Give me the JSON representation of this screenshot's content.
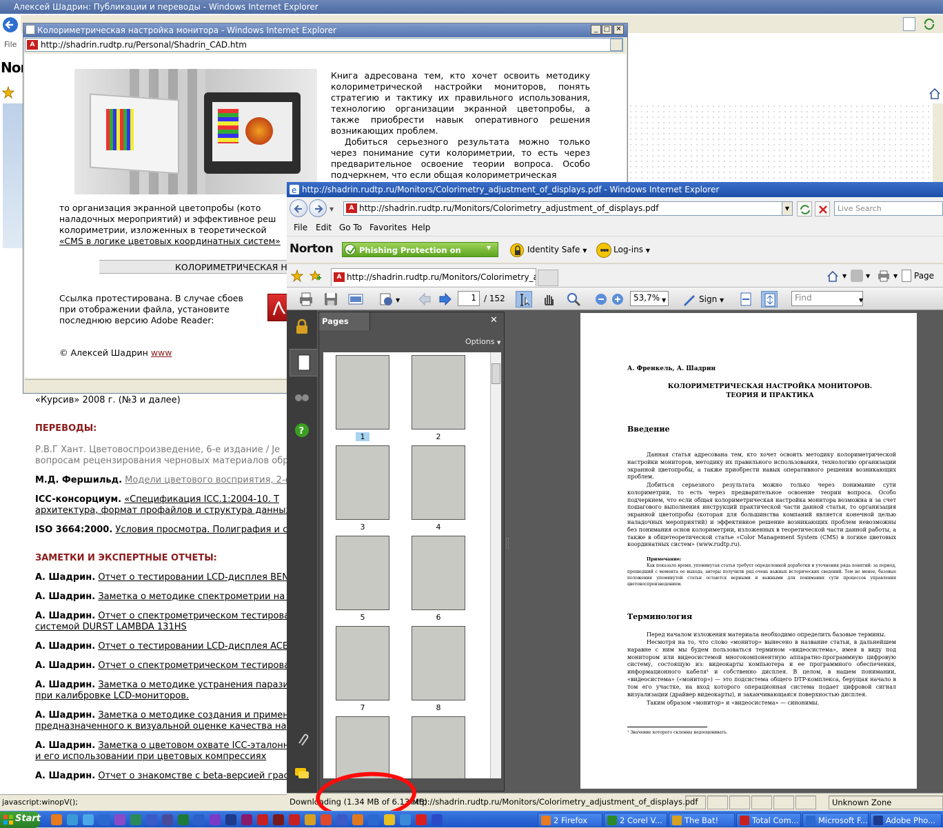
{
  "back_window": {
    "title": "Алексей Шадрин: Публикации и переводы - Windows Internet Explorer",
    "menu_file": "File",
    "logo_text": "Nor",
    "status": "javascript:winopV();",
    "lines": [
      {
        "kind": "plain",
        "text": "«Курсив» 2008 г. (№3 и далее)"
      },
      {
        "kind": "section",
        "text": "ПЕРЕВОДЫ:"
      },
      {
        "kind": "grey",
        "text": "Р.В.Г Хант. Цветовоспроизведение, 6-е издание / Je"
      },
      {
        "kind": "grey",
        "text": "вопросам рецензирования черновых материалов обр"
      },
      {
        "kind": "entry",
        "author": "М.Д. Фершильд.",
        "link": "Модели цветового восприятия, 2-е"
      },
      {
        "kind": "entry",
        "author": "ICC-консорциум.",
        "link": "«Спецификация ICC.1:2004-10. Т"
      },
      {
        "kind": "link",
        "text": "архитектура, формат профайлов и структура данных"
      },
      {
        "kind": "entry",
        "author": "ISO 3664:2000.",
        "link": "Условия просмотра. Полиграфия и с"
      },
      {
        "kind": "section",
        "text": "ЗАМЕТКИ И ЭКСПЕРТНЫЕ ОТЧЕТЫ:"
      },
      {
        "kind": "entry",
        "author": "А. Шадрин.",
        "link": "Отчет о тестировании LCD-дисплея BENC"
      },
      {
        "kind": "entry",
        "author": "А. Шадрин.",
        "link": "Заметка о методике спектрометрии на г"
      },
      {
        "kind": "entry",
        "author": "А. Шадрин.",
        "link": "Отчет о спектрометрическом тестирова"
      },
      {
        "kind": "link",
        "text": "системой DURST LAMBDA 131HS"
      },
      {
        "kind": "entry",
        "author": "А. Шадрин.",
        "link": "Отчет о тестировании LCD-дисплея ACEI"
      },
      {
        "kind": "entry",
        "author": "А. Шадрин.",
        "link": "Отчет о спектрометрическом тестирова"
      },
      {
        "kind": "entry",
        "author": "А. Шадрин.",
        "link": "Заметка о методике устранения паразит"
      },
      {
        "kind": "link",
        "text": "при калибровке LCD-мониторов."
      },
      {
        "kind": "entry",
        "author": "А. Шадрин.",
        "link": "Заметка о методике создания и примене"
      },
      {
        "kind": "link",
        "text": "предназначенного к визуальной оценке качества на"
      },
      {
        "kind": "entry",
        "author": "А. Шадрин.",
        "link": "Заметка о цветовом охвате ICC-эталонн"
      },
      {
        "kind": "link",
        "text": "и его использовании при цветовых компрессиях"
      },
      {
        "kind": "entry",
        "author": "А. Шадрин.",
        "link": "Отчет о знакомстве с beta-версией грас"
      }
    ]
  },
  "popup_window": {
    "title": "Колориметрическая настройка монитора - Windows Internet Explorer",
    "url": "http://shadrin.rudtp.ru/Personal/Shadrin_CAD.htm",
    "para1": "Книга адресована тем, кто хочет освоить методику колориметрической настройки мониторов, понять стратегию и тактику их правильного использования, технологию организации экранной цветопробы, а также приобрести навык оперативного решения возникающих проблем.",
    "para2": "Добиться серьезного результата можно только через понимание сути колориметрии, то есть через предварительное освоение теории вопроса. Особо подчеркнем, что если общая колориметрическая",
    "lower_lines": [
      "то организация экранной цветопробы (кото",
      "наладочных мероприятий) и эффективное реш",
      "колориметрии, изложенных в теоретической",
      "«CMS в логике цветовых координатных систем»"
    ],
    "banner": "КОЛОРИМЕТРИЧЕСКАЯ НА",
    "note": "Ссылка протестирована. В случае сбоев при отображении файла, установите последнюю версию Adobe Reader:",
    "copyright": "© Алексей Шадрин",
    "copyright_link": "www"
  },
  "main_window": {
    "title": "http://shadrin.rudtp.ru/Monitors/Colorimetry_adjustment_of_displays.pdf - Windows Internet Explorer",
    "url": "http://shadrin.rudtp.ru/Monitors/Colorimetry_adjustment_of_displays.pdf",
    "search_placeholder": "Live Search",
    "menu": [
      "File",
      "Edit",
      "Go To",
      "Favorites",
      "Help"
    ],
    "norton": {
      "logo": "Norton",
      "phishing": "Phishing Protection on",
      "identity": "Identity Safe",
      "logins": "Log-ins"
    },
    "tab_label": "http://shadrin.rudtp.ru/Monitors/Colorimetry_adjustm...",
    "page_menu": "Page",
    "pdf_toolbar": {
      "page": "1",
      "page_total": "/ 152",
      "zoom": "53,7%",
      "sign": "Sign",
      "find_placeholder": "Find"
    },
    "pages_panel": {
      "title": "Pages",
      "options": "Options",
      "thumbs": [
        "1",
        "2",
        "3",
        "4",
        "5",
        "6",
        "7",
        "8"
      ]
    },
    "status": {
      "downloading": "Downloading (1.34 MB of 6.13 MB)",
      "url": "http://shadrin.rudtp.ru/Monitors/Colorimetry_adjustment_of_displays.pdf",
      "zone": "Unknown Zone"
    }
  },
  "document": {
    "authors": "А. Френкель,  А. Шадрин",
    "title1": "КОЛОРИМЕТРИЧЕСКАЯ НАСТРОЙКА МОНИТОРОВ.",
    "title2": "ТЕОРИЯ И ПРАКТИКА",
    "h_intro": "Введение",
    "p1": "Данная статья адресована тем, кто хочет освоить методику колориметрической настройки мониторов, методику их правильного использования, технологию организации экранной цветопробы, а также приобрести навык оперативного решения возникающих проблем.",
    "p2": "Добиться серьезного результата можно только через понимание сути колориметрии, то есть через предварительное освоение теории вопроса. Особо подчеркнем, что если общая колориметрическая настройка монитора возможна и за счет пошагового выполнения инструкций практической части данной статьи, то организация экранной цветопробы (которая для большинства компаний является конечной целью наладочных мероприятий) и эффективное решение возникающих проблем невозможны без понимания основ колориметрии, изложенных в теоретической части данной работы, а также в общетеоретической статье «Color Management System (CMS) в логике цветовых координатных систем» (www.rudtp.ru).",
    "note_title": "Примечание:",
    "note_text": "Как показало время, упомянутая статья требует определенной доработки и уточнения ряда понятий: за период, прошедший с момента ее выхода, авторы получили ряд очень важных исторических сведений. Тем не менее, базовые положения упомянутой статьи остаются верными и важными для понимания сути процессов управления цветовоспроизведением.",
    "h_term": "Терминология",
    "p3": "Перед началом изложения материала необходимо определить базовые термины.",
    "p4": "Несмотря на то, что слово «монитор» вынесено в название статьи, в дальнейшем наравне с ним мы будем пользоваться термином «видеосистема», имея в виду под монитором или видеосистемой многокомпонентную аппаратно-программную цифровую систему, состоящую из: видеокарты компьютера и ее программного обеспечения, информационного кабеля¹ и собственно дисплея. В целом, в нашем понимании, «видеосистема» («монитор») — это подсистема общего DTP-комплекса, берущая начало в том его участке, на вход которого операционная система подает цифровой сигнал визуализации (драйвер видеокарты), и заканчивающаяся поверхностью дисплея.",
    "p5": "Таким образом «монитор» и «видеосистема» — синонимы.",
    "footnote": "¹ Значение которого склонны недооценивать."
  },
  "taskbar": {
    "start": "Start",
    "tasks": [
      "2 Firefox",
      "2 Corel V...",
      "The Bat!",
      "Total Com...",
      "Microsoft F...",
      "Adobe Pho..."
    ]
  }
}
